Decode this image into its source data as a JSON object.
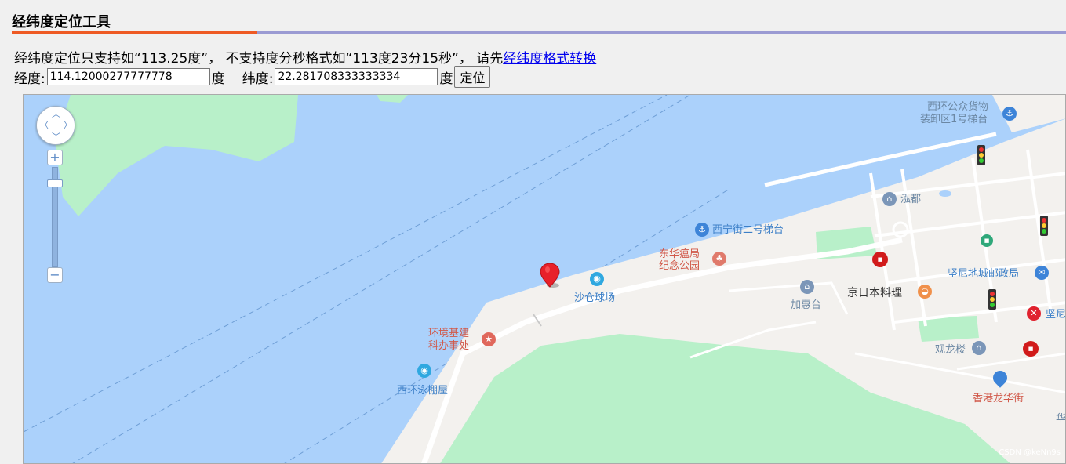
{
  "page": {
    "title": "经纬度定位工具",
    "notice_text": "经纬度定位只支持如“113.25度”， 不支持度分秒格式如“113度23分15秒”， 请先",
    "notice_link": "经纬度格式转换"
  },
  "form": {
    "lng_label": "经度:",
    "lng_value": "114.12000277777778",
    "lng_unit": "度",
    "lat_label": "纬度:",
    "lat_value": "22.281708333333334",
    "lat_unit": "度",
    "locate_button": "定位"
  },
  "map": {
    "colors": {
      "water": "#abd1fb",
      "land": "#f3f1ee",
      "park": "#b8f0c9",
      "road": "#ffffff",
      "marker": "#e8202a"
    },
    "labels": {
      "xihuan_cargo_1": "西环公众货物",
      "xihuan_cargo_2": "装卸区1号梯台",
      "hongdu": "泓都",
      "xining_street": "西宁街二号梯台",
      "donghua_1": "东华瘟局",
      "donghua_2": "纪念公园",
      "shacang": "沙仓球场",
      "jiahuitai": "加惠台",
      "jingri": "京日本料理",
      "kennedy_post": "坚尼地城邮政局",
      "kennedy_mtr": "坚尼",
      "env_office_1": "环境基建",
      "env_office_2": "科办事处",
      "guanlonglou": "观龙楼",
      "xihuan_pool": "西环泳棚屋",
      "longhua_street": "香港龙华街",
      "hua_partial": "华"
    },
    "watermark": "CSDN @keNn9s"
  }
}
